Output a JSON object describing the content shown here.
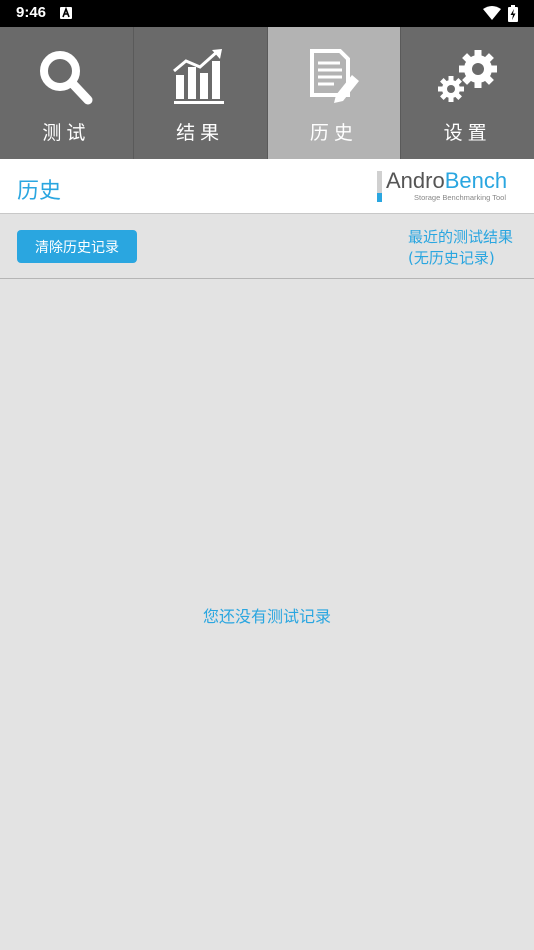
{
  "status_bar": {
    "time": "9:46",
    "icons": [
      "notification-a-icon",
      "wifi-icon",
      "battery-charging-icon"
    ]
  },
  "tabs": [
    {
      "label": "测试",
      "icon": "search-icon",
      "active": false
    },
    {
      "label": "结果",
      "icon": "bar-chart-icon",
      "active": false
    },
    {
      "label": "历史",
      "icon": "document-edit-icon",
      "active": true
    },
    {
      "label": "设置",
      "icon": "gears-icon",
      "active": false
    }
  ],
  "header": {
    "title": "历史",
    "logo": {
      "name_part1": "Andro",
      "name_part2": "Bench",
      "subtitle": "Storage Benchmarking Tool"
    }
  },
  "actions": {
    "clear_button": "清除历史记录",
    "recent_line1": "最近的测试结果",
    "recent_line2": "(无历史记录)"
  },
  "empty_message": "您还没有测试记录",
  "colors": {
    "accent": "#2aa6e0",
    "tab_bg": "#6a6a6a",
    "tab_active_bg": "#b3b3b3",
    "content_bg": "#e3e3e3"
  }
}
